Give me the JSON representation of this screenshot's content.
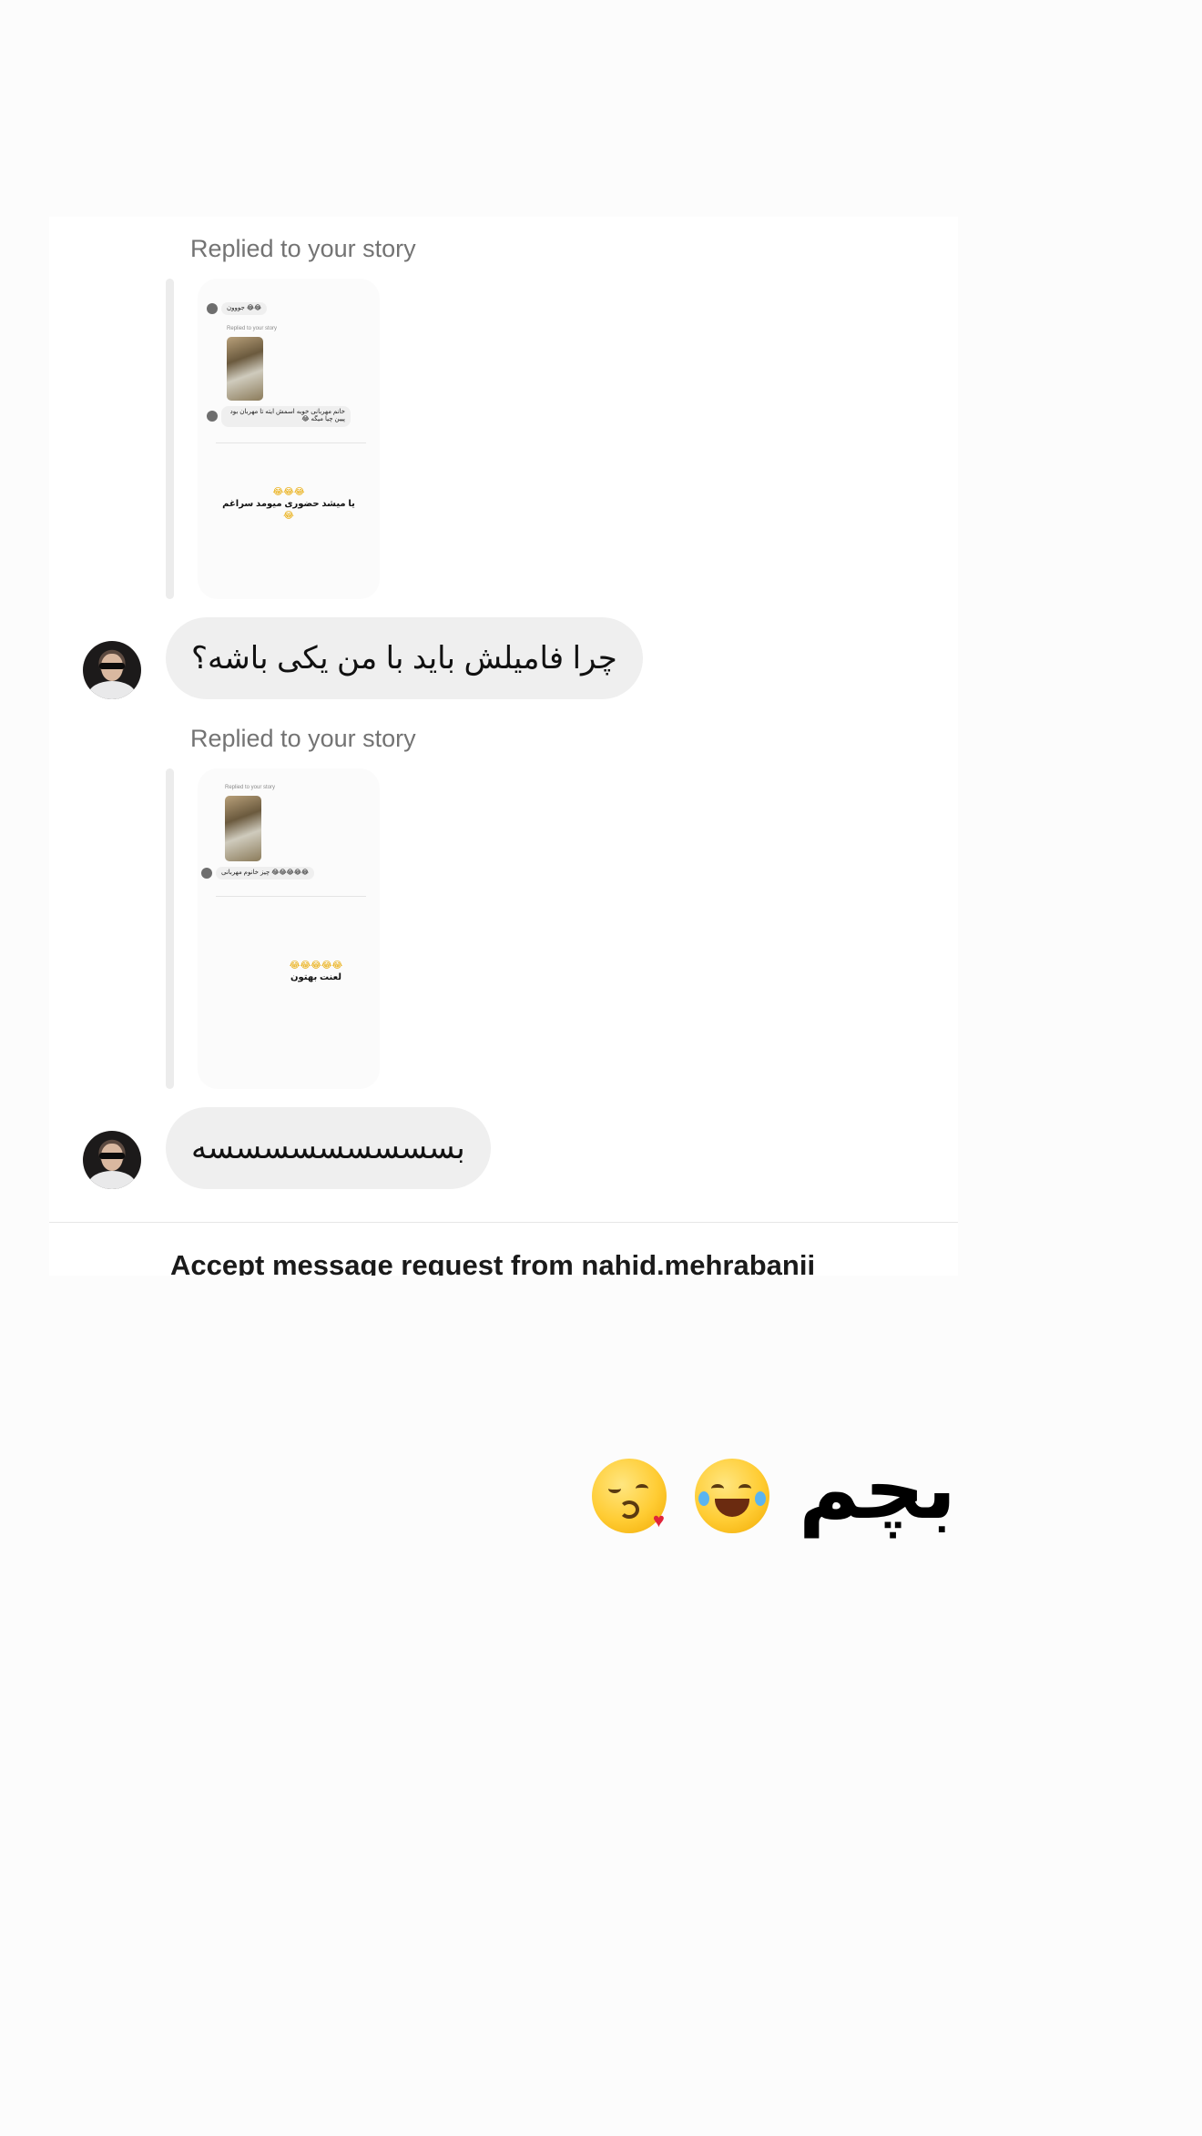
{
  "conversation": {
    "messages": [
      {
        "reply_label": "Replied to your story",
        "story_preview": {
          "top_bubble_1": "جووون",
          "top_bubble_emoji_1": "😂😂",
          "inner_reply_label": "Replied to your story",
          "inner_bubble": "خانم مهربانی خوبه اسمش ایته تا مهربان بود پیین چیا میگه 😂",
          "caption_emoji": "😂😂😂",
          "caption": "یا میشد حضوری میومد سراغم",
          "caption_emoji_2": "😂"
        },
        "text": "چرا فامیلش باید با من یکی باشه؟"
      },
      {
        "reply_label": "Replied to your story",
        "story_preview": {
          "inner_reply_label": "Replied to your story",
          "inner_bubble": "😂😂😂😂😂 چیز خانوم مهربانی",
          "caption_emoji": "😂😂😂😂😂",
          "caption": "لعنت بهتون"
        },
        "text": "بسسسسسسسسسه"
      }
    ],
    "accept_request_title": "Accept message request from nahid.mehrabanii"
  },
  "overlay": {
    "text": "بچم",
    "emojis": [
      "rolling-on-floor-laughing",
      "face-blowing-kiss"
    ]
  }
}
